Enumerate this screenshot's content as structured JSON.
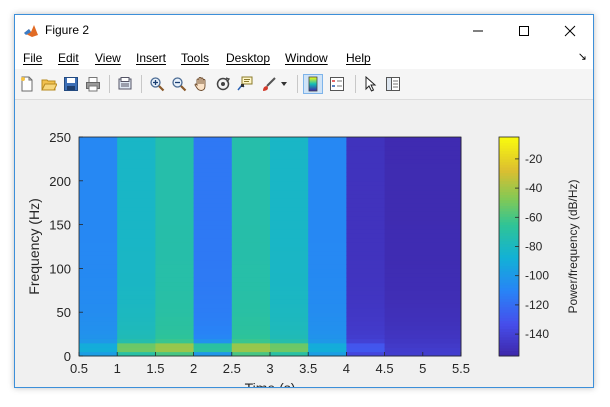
{
  "window": {
    "title": "Figure 2"
  },
  "menu": [
    "File",
    "Edit",
    "View",
    "Insert",
    "Tools",
    "Desktop",
    "Window",
    "Help"
  ],
  "toolbar_icons": [
    "new-figure-icon",
    "open-file-icon",
    "save-icon",
    "print-icon",
    "print-preview-icon",
    "zoom-in-icon",
    "zoom-out-icon",
    "pan-icon",
    "rotate-3d-icon",
    "data-cursor-icon",
    "brush-icon",
    "brush-dropdown-icon",
    "insert-colorbar-icon",
    "insert-legend-icon",
    "edit-plot-icon",
    "property-inspector-icon"
  ],
  "chart_data": {
    "type": "heatmap",
    "xlabel": "Time (s)",
    "ylabel": "Frequency (Hz)",
    "colorbar_label": "Power/frequency (dB/Hz)",
    "xlim": [
      0.5,
      5.5
    ],
    "ylim": [
      0,
      250
    ],
    "clim": [
      -155,
      -5
    ],
    "x_ticks": [
      "0.5",
      "1",
      "1.5",
      "2",
      "2.5",
      "3",
      "3.5",
      "4",
      "4.5",
      "5",
      "5.5"
    ],
    "y_ticks": [
      "0",
      "50",
      "100",
      "150",
      "200",
      "250"
    ],
    "colorbar_ticks": [
      "-20",
      "-40",
      "-60",
      "-80",
      "-100",
      "-120",
      "-140"
    ],
    "colormap": "parula",
    "segments": [
      {
        "t_start": 0.5,
        "t_end": 1.0,
        "power_db": -108,
        "peak_hz": 10,
        "peak_db": -78
      },
      {
        "t_start": 1.0,
        "t_end": 1.5,
        "power_db": -82,
        "peak_hz": 10,
        "peak_db": -20
      },
      {
        "t_start": 1.5,
        "t_end": 2.0,
        "power_db": -72,
        "peak_hz": 10,
        "peak_db": -12
      },
      {
        "t_start": 2.0,
        "t_end": 2.5,
        "power_db": -115,
        "peak_hz": 10,
        "peak_db": -8
      },
      {
        "t_start": 2.5,
        "t_end": 3.0,
        "power_db": -72,
        "peak_hz": 10,
        "peak_db": -12
      },
      {
        "t_start": 3.0,
        "t_end": 3.5,
        "power_db": -82,
        "peak_hz": 10,
        "peak_db": -20
      },
      {
        "t_start": 3.5,
        "t_end": 4.0,
        "power_db": -108,
        "peak_hz": 10,
        "peak_db": -78
      },
      {
        "t_start": 4.0,
        "t_end": 4.5,
        "power_db": -148,
        "peak_hz": 10,
        "peak_db": -118
      },
      {
        "t_start": 4.5,
        "t_end": 5.5,
        "power_db": -152,
        "peak_hz": 10,
        "peak_db": -150
      }
    ]
  }
}
